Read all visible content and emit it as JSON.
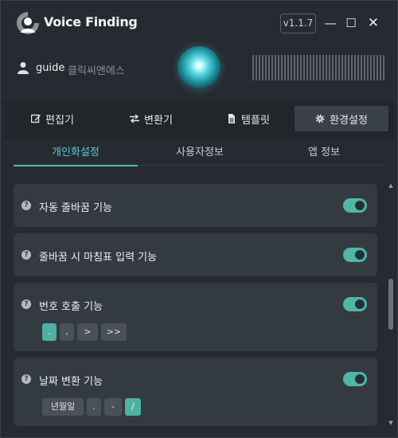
{
  "app": {
    "name": "Voice Finding",
    "version": "v1.1.7"
  },
  "window_controls": {
    "minimize": "—",
    "maximize": "☐",
    "close": "✕"
  },
  "user": {
    "name": "guide",
    "organization": "클릭씨앤에스"
  },
  "main_tabs": [
    {
      "label": "편집기",
      "icon": "edit-icon",
      "active": false
    },
    {
      "label": "변환기",
      "icon": "swap-icon",
      "active": false
    },
    {
      "label": "템플릿",
      "icon": "document-icon",
      "active": false
    },
    {
      "label": "환경설정",
      "icon": "gear-icon",
      "active": true
    }
  ],
  "sub_tabs": [
    {
      "label": "개인화설정",
      "active": true
    },
    {
      "label": "사용자정보",
      "active": false
    },
    {
      "label": "앱 정보",
      "active": false
    }
  ],
  "settings": [
    {
      "label": "자동 줄바꿈 기능",
      "enabled": true,
      "options": []
    },
    {
      "label": "줄바꿈 시 마침표 입력 기능",
      "enabled": true,
      "options": []
    },
    {
      "label": "번호 호출 기능",
      "enabled": true,
      "options": [
        {
          "label": ".",
          "selected": true
        },
        {
          "label": ",",
          "selected": false
        },
        {
          "label": ">",
          "selected": false
        },
        {
          "label": ">>",
          "selected": false
        }
      ]
    },
    {
      "label": "날짜 변환 기능",
      "enabled": true,
      "options": [
        {
          "label": "년월일",
          "selected": false
        },
        {
          "label": ".",
          "selected": false
        },
        {
          "label": "-",
          "selected": false
        },
        {
          "label": "/",
          "selected": true
        }
      ]
    }
  ],
  "help_glyph": "?",
  "colors": {
    "accent": "#4fb6a8",
    "accent_text": "#5cc9d6",
    "panel": "#333b41",
    "background": "#252b30"
  }
}
